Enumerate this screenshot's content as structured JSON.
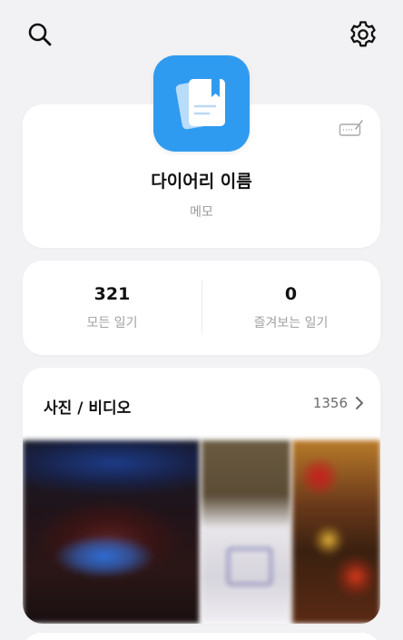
{
  "topbar": {
    "search_icon": "search-icon",
    "settings_icon": "gear-icon"
  },
  "profile": {
    "app_icon": "diary-book-icon",
    "edit_icon": "edit-icon",
    "name": "다이어리 이름",
    "memo": "메모"
  },
  "stats": {
    "all_count": "321",
    "all_label": "모든 일기",
    "favorites_count": "0",
    "favorites_label": "즐겨보는 일기"
  },
  "media": {
    "title": "사진 / 비디오",
    "count": "1356",
    "chevron_icon": "chevron-right-icon"
  },
  "colors": {
    "background": "#f2f2f4",
    "accent": "#2f9bf0",
    "card": "#ffffff"
  }
}
